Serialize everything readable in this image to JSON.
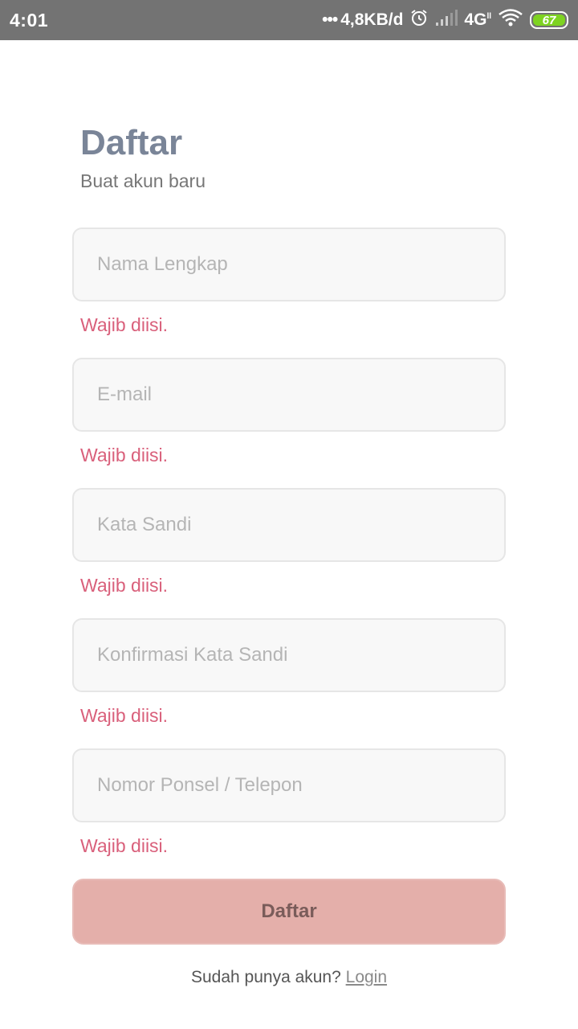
{
  "status_bar": {
    "time": "4:01",
    "dots": "•••",
    "speed": "4,8KB/d",
    "network": "4G",
    "network_sub": "ll",
    "battery": "67",
    "battery_color": "#7ed321"
  },
  "header": {
    "title": "Daftar",
    "subtitle": "Buat akun baru"
  },
  "form": {
    "fields": [
      {
        "placeholder": "Nama Lengkap",
        "error": "Wajib diisi."
      },
      {
        "placeholder": "E-mail",
        "error": "Wajib diisi."
      },
      {
        "placeholder": "Kata Sandi",
        "error": "Wajib diisi."
      },
      {
        "placeholder": "Konfirmasi Kata Sandi",
        "error": "Wajib diisi."
      },
      {
        "placeholder": "Nomor Ponsel / Telepon",
        "error": "Wajib diisi."
      }
    ],
    "submit_label": "Daftar"
  },
  "footer": {
    "prompt": "Sudah punya akun?",
    "login_label": "Login"
  },
  "colors": {
    "title": "#7a8598",
    "error": "#d9607b",
    "button": "#e4afaa",
    "status_bar": "#737373"
  }
}
